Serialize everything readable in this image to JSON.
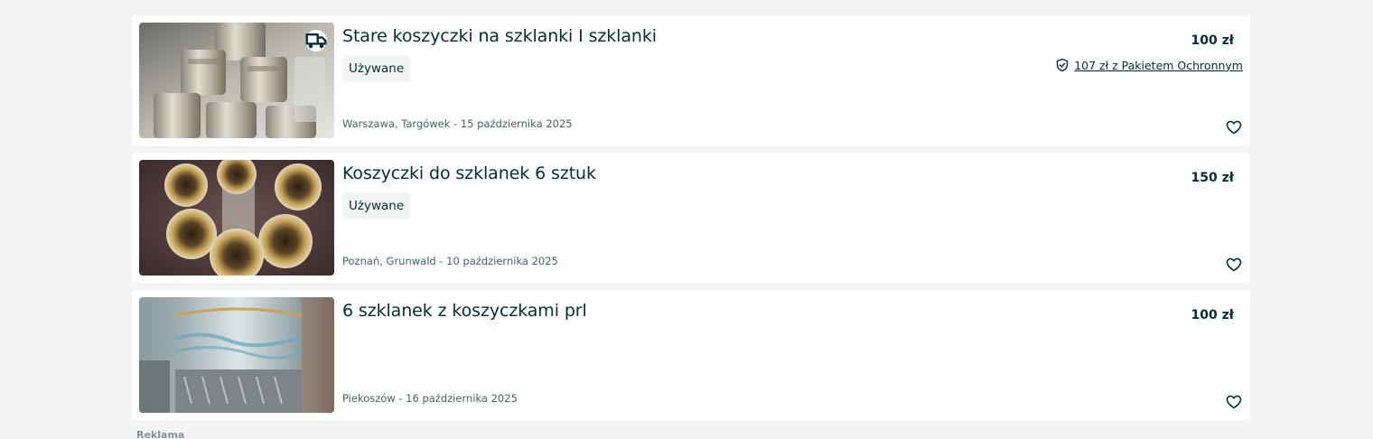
{
  "listings": [
    {
      "title": "Stare koszyczki na szklanki I szklanki",
      "condition": "Używane",
      "location": "Warszawa, Targówek - 15 października 2025",
      "price": "100 zł",
      "protection": "107 zł z Pakietem Ochronnym",
      "delivery_icon": "truck-icon",
      "favorite_icon": "heart-icon"
    },
    {
      "title": "Koszyczki do szklanek 6 sztuk",
      "condition": "Używane",
      "location": "Poznań, Grunwald - 10 października 2025",
      "price": "150 zł",
      "favorite_icon": "heart-icon"
    },
    {
      "title": "6 szklanek z koszyczkami prl",
      "location": "Piekoszów - 16 października 2025",
      "price": "100 zł",
      "favorite_icon": "heart-icon"
    }
  ],
  "ad_label": "Reklama",
  "colors": {
    "background": "#f2f4f5",
    "card": "#ffffff",
    "text": "#002f34",
    "muted": "#406367"
  }
}
